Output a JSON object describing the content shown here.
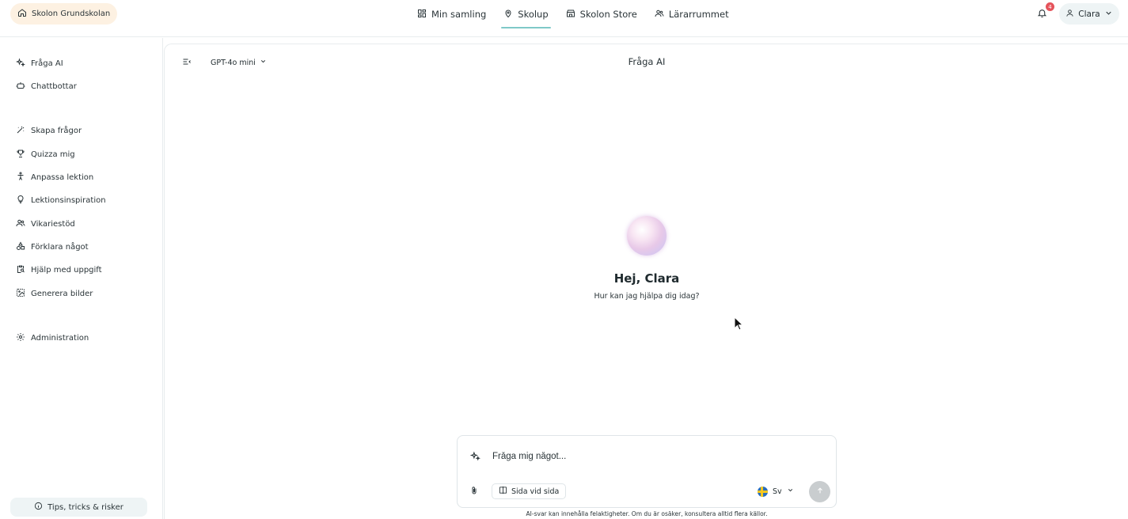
{
  "topbar": {
    "school": "Skolon Grundskolan",
    "nav": [
      {
        "label": "Min samling",
        "icon": "grid-icon",
        "active": false
      },
      {
        "label": "Skolup",
        "icon": "pin-icon",
        "active": true
      },
      {
        "label": "Skolon Store",
        "icon": "store-icon",
        "active": false
      },
      {
        "label": "Lärarrummet",
        "icon": "people-icon",
        "active": false
      }
    ],
    "notifications_count": "4",
    "user_name": "Clara"
  },
  "sidebar": {
    "items": [
      {
        "label": "Fråga AI",
        "icon": "sparkles-icon"
      },
      {
        "label": "Chattbottar",
        "icon": "robot-icon"
      },
      {
        "label": "Skapa frågor",
        "icon": "wand-icon"
      },
      {
        "label": "Quizza mig",
        "icon": "trophy-icon"
      },
      {
        "label": "Anpassa lektion",
        "icon": "person-icon"
      },
      {
        "label": "Lektionsinspiration",
        "icon": "lightbulb-icon"
      },
      {
        "label": "Vikariestöd",
        "icon": "users-icon"
      },
      {
        "label": "Förklara något",
        "icon": "shapes-icon"
      },
      {
        "label": "Hjälp med uppgift",
        "icon": "clipboard-search-icon"
      },
      {
        "label": "Generera bilder",
        "icon": "image-icon"
      },
      {
        "label": "Administration",
        "icon": "gear-icon"
      }
    ],
    "tips_label": "Tips, tricks & risker"
  },
  "main": {
    "model": "GPT-4o mini",
    "title": "Fråga AI",
    "greeting": "Hej, Clara",
    "subgreeting": "Hur kan jag hjälpa dig idag?",
    "composer": {
      "placeholder": "Fråga mig något...",
      "side_by_side_label": "Sida vid sida",
      "language": "Sv"
    },
    "disclaimer": "AI-svar kan innehålla felaktigheter. Om du är osäker, konsultera alltid flera källor."
  },
  "colors": {
    "accent_underline": "#7fc9c8",
    "school_pill_bg": "#fdf1e2",
    "user_pill_bg": "#eef4f5",
    "badge": "#e5535b"
  }
}
